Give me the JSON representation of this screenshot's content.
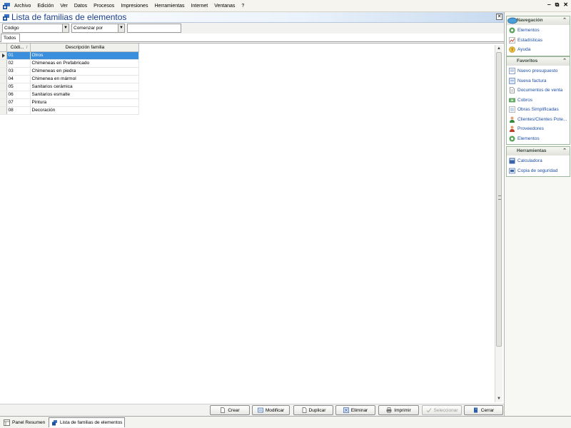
{
  "menubar": {
    "items": [
      "Archivo",
      "Edición",
      "Ver",
      "Datos",
      "Procesos",
      "Impresiones",
      "Herramientas",
      "Internet",
      "Ventanas",
      "?"
    ],
    "window_controls": [
      "‒",
      "⧉",
      "✕"
    ]
  },
  "window": {
    "title": "Lista de familias de elementos",
    "close_glyph": "✕"
  },
  "filters": {
    "field_combo": "Código",
    "mode_combo": "Comenzar por",
    "search_value": ""
  },
  "tabs": [
    "Todos"
  ],
  "grid": {
    "columns": [
      "Códi...",
      "Descripción familia"
    ],
    "sort_glyph": "/",
    "rows": [
      {
        "code": "01",
        "desc": "Otros"
      },
      {
        "code": "02",
        "desc": "Chimeneas en Prefabricado"
      },
      {
        "code": "03",
        "desc": "Chimeneas en piedra"
      },
      {
        "code": "04",
        "desc": "Chimenea en mármol"
      },
      {
        "code": "05",
        "desc": "Sanitarios cerámica"
      },
      {
        "code": "06",
        "desc": "Sanitarios esmalte"
      },
      {
        "code": "07",
        "desc": "Pintura"
      },
      {
        "code": "08",
        "desc": "Decoración"
      }
    ],
    "selected_index": 0
  },
  "buttons": {
    "crear": "Crear",
    "modificar": "Modificar",
    "duplicar": "Duplicar",
    "eliminar": "Eliminar",
    "imprimir": "Imprimir",
    "seleccionar": "Seleccionar",
    "cerrar": "Cerrar"
  },
  "status_tabs": [
    "Panel Resumen",
    "Lista de familias de elementos"
  ],
  "sidebar": {
    "navegacion": {
      "title": "Navegación",
      "items": [
        "Elementos",
        "Estadísticas",
        "Ayuda"
      ]
    },
    "favoritos": {
      "title": "Favoritos",
      "items": [
        "Nuevo presupuesto",
        "Nueva factura",
        "Documentos de venta",
        "Cobros",
        "Obras Simplificadas",
        "Clientes/Clientes Pote...",
        "Proveedores",
        "Elementos"
      ]
    },
    "herramientas": {
      "title": "Herramientas",
      "items": [
        "Calculadora",
        "Copia de seguridad"
      ]
    }
  },
  "colors": {
    "selection": "#3a8fdd",
    "link": "#1e4fa6",
    "title": "#1c3f8a"
  }
}
